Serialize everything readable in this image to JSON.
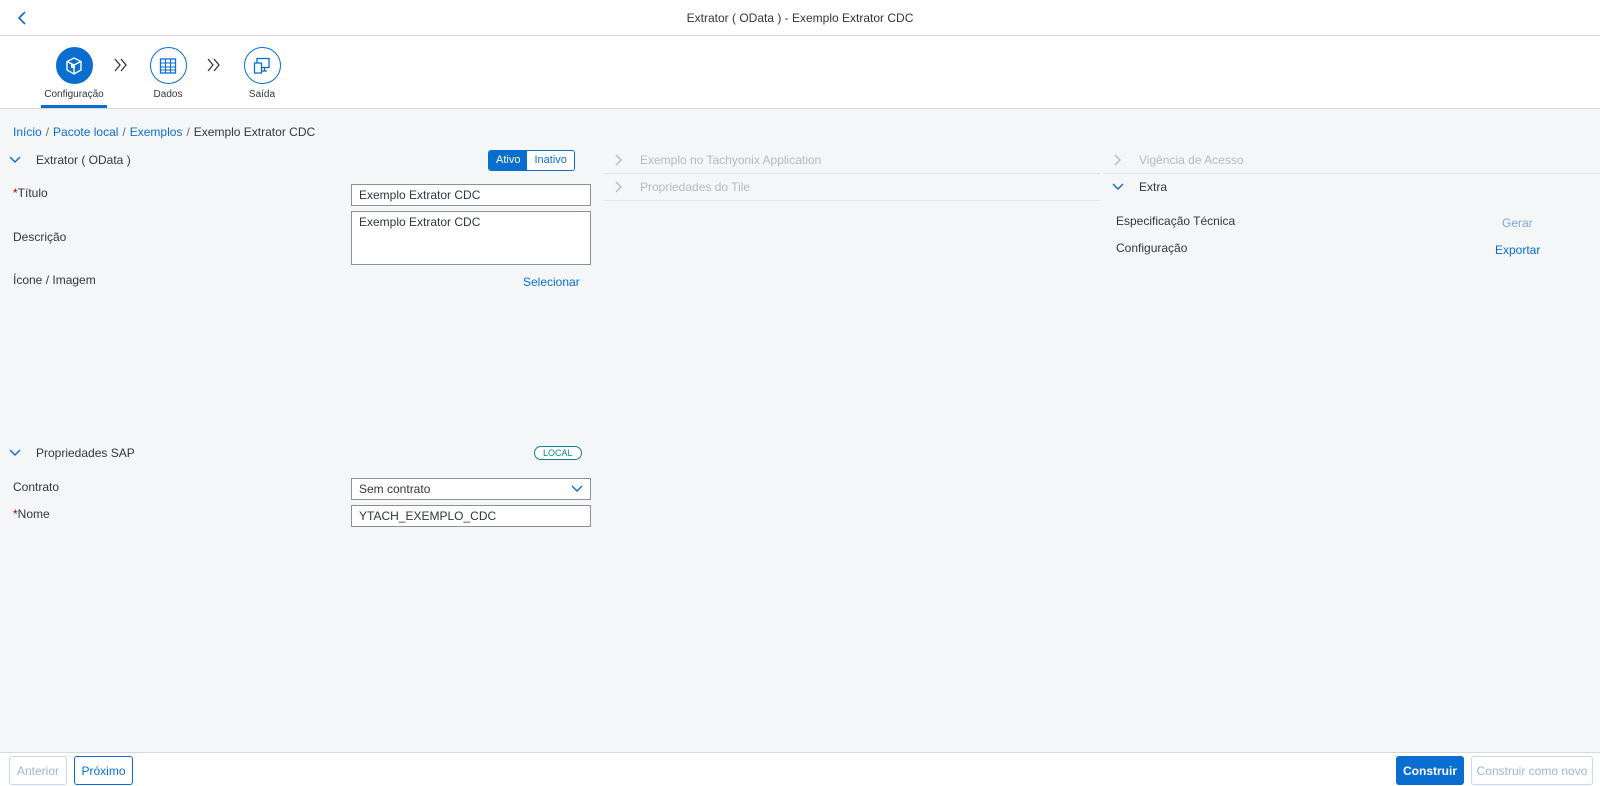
{
  "shell": {
    "title": "Extrator ( OData ) - Exemplo Extrator CDC"
  },
  "wizard": {
    "steps": [
      {
        "label": "Configuração"
      },
      {
        "label": "Dados"
      },
      {
        "label": "Saída"
      }
    ]
  },
  "breadcrumb": {
    "items": [
      "Início",
      "Pacote local",
      "Exemplos"
    ],
    "current": "Exemplo Extrator CDC"
  },
  "extractor_panel": {
    "title": "Extrator ( OData )",
    "status_options": [
      "Ativo",
      "Inativo"
    ],
    "selected_status": "Ativo",
    "fields": {
      "title_label": "Título",
      "title_value": "Exemplo Extrator CDC",
      "description_label": "Descrição",
      "description_value": "Exemplo Extrator CDC",
      "icon_label": "Ícone / Imagem",
      "icon_action": "Selecionar"
    }
  },
  "middle_panels": {
    "app_example": "Exemplo no Tachyonix Application",
    "tile_props": "Propriedades do Tile"
  },
  "right_panels": {
    "access": "Vigência de Acesso",
    "extra": "Extra",
    "tech_spec_label": "Especificação Técnica",
    "tech_spec_action": "Gerar",
    "config_label": "Configuração",
    "config_action": "Exportar"
  },
  "sap_panel": {
    "title": "Propriedades SAP",
    "badge": "LOCAL",
    "contract_label": "Contrato",
    "contract_value": "Sem contrato",
    "name_label": "Nome",
    "name_value": "YTACH_EXEMPLO_CDC"
  },
  "footer": {
    "prev": "Anterior",
    "next": "Próximo",
    "build": "Construir",
    "build_new": "Construir como novo"
  },
  "colors": {
    "accent": "#0a6ed1",
    "required": "#bb0000",
    "badge": "#0f828f"
  }
}
